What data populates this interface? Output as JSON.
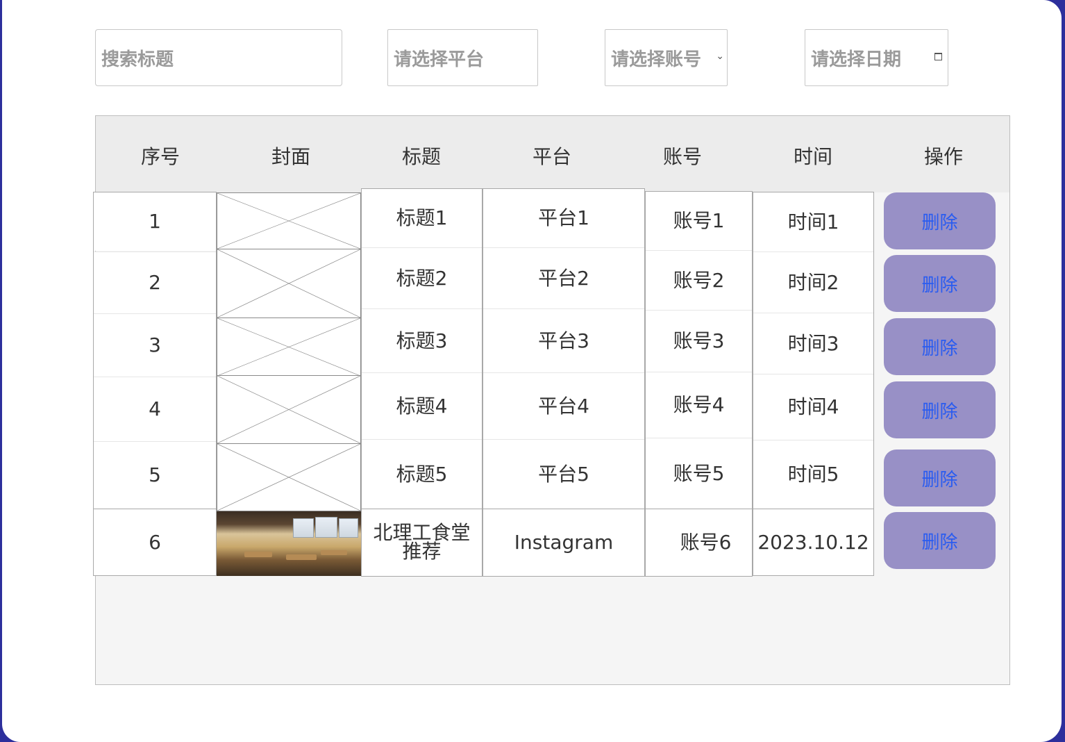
{
  "filters": {
    "title_placeholder": "搜索标题",
    "platform_placeholder": "请选择平台",
    "account_placeholder": "请选择账号",
    "date_placeholder": "请选择日期"
  },
  "table": {
    "headers": [
      "序号",
      "封面",
      "标题",
      "平台",
      "账号",
      "时间",
      "操作"
    ],
    "rows": [
      {
        "index": "1",
        "title": "标题1",
        "platform": "平台1",
        "account": "账号1",
        "time": "时间1",
        "action": "删除",
        "cover": "broken-image"
      },
      {
        "index": "2",
        "title": "标题2",
        "platform": "平台2",
        "account": "账号2",
        "time": "时间2",
        "action": "删除",
        "cover": "broken-image"
      },
      {
        "index": "3",
        "title": "标题3",
        "platform": "平台3",
        "account": "账号3",
        "time": "时间3",
        "action": "删除",
        "cover": "broken-image"
      },
      {
        "index": "4",
        "title": "标题4",
        "platform": "平台4",
        "account": "账号4",
        "time": "时间4",
        "action": "删除",
        "cover": "broken-image"
      },
      {
        "index": "5",
        "title": "标题5",
        "platform": "平台5",
        "account": "账号5",
        "time": "时间5",
        "action": "删除",
        "cover": "broken-image"
      },
      {
        "index": "6",
        "title": "北理工食堂推荐",
        "title_line1": "北理工食堂",
        "title_line2": "推荐",
        "platform": "Instagram",
        "account": "账号6",
        "time": "2023.10.12",
        "action": "删除",
        "cover": "cafeteria-photo"
      }
    ]
  },
  "colors": {
    "frame": "#2d2f9c",
    "header_bg": "#ececec",
    "button_bg": "#9890c6",
    "button_text": "#2a5cf0",
    "placeholder": "#9a9a9a"
  }
}
